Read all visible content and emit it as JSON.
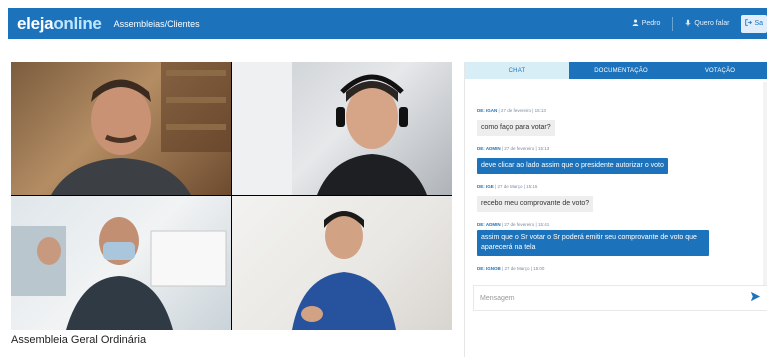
{
  "header": {
    "logo_left": "eleja",
    "logo_right": "online",
    "section_title": "Assembleias/Clientes",
    "user_label": "Pedro",
    "speak_label": "Quero falar",
    "exit_label": "Sa",
    "brand_color": "#1d73bb",
    "icons": [
      "user-icon",
      "microphone-icon",
      "exit-icon"
    ]
  },
  "meeting": {
    "title": "Assembleia Geral Ordinária"
  },
  "chat_panel": {
    "tabs": [
      {
        "label": "CHAT",
        "active": true
      },
      {
        "label": "DOCUMENTAÇÃO",
        "active": false
      },
      {
        "label": "VOTAÇÃO",
        "active": false
      }
    ],
    "messages": [
      {
        "who": "DE: IGAN",
        "when": "| 27 de fevereiro | 15:13",
        "text": "como faço para votar?",
        "role": "user"
      },
      {
        "who": "DE: ADMIN",
        "when": "| 27 de fevereiro | 15:13",
        "text": "deve clicar ao lado assim que o presidente autorizar o voto",
        "role": "admin"
      },
      {
        "who": "DE: IGE",
        "when": "| 27 de Março | 15:15",
        "text": "recebo meu comprovante de voto?",
        "role": "user"
      },
      {
        "who": "DE: ADMIN",
        "when": "| 27 de fevereiro | 15:41",
        "text": "assim que o Sr votar o Sr poderá emitir seu comprovante de voto que aparecerá na tela",
        "role": "admin"
      },
      {
        "who": "DE: IGNOB",
        "when": "| 27 de Março | 15:00",
        "text": "",
        "role": "user"
      }
    ],
    "input_placeholder": "Mensagem",
    "send_icon": "send-icon"
  }
}
